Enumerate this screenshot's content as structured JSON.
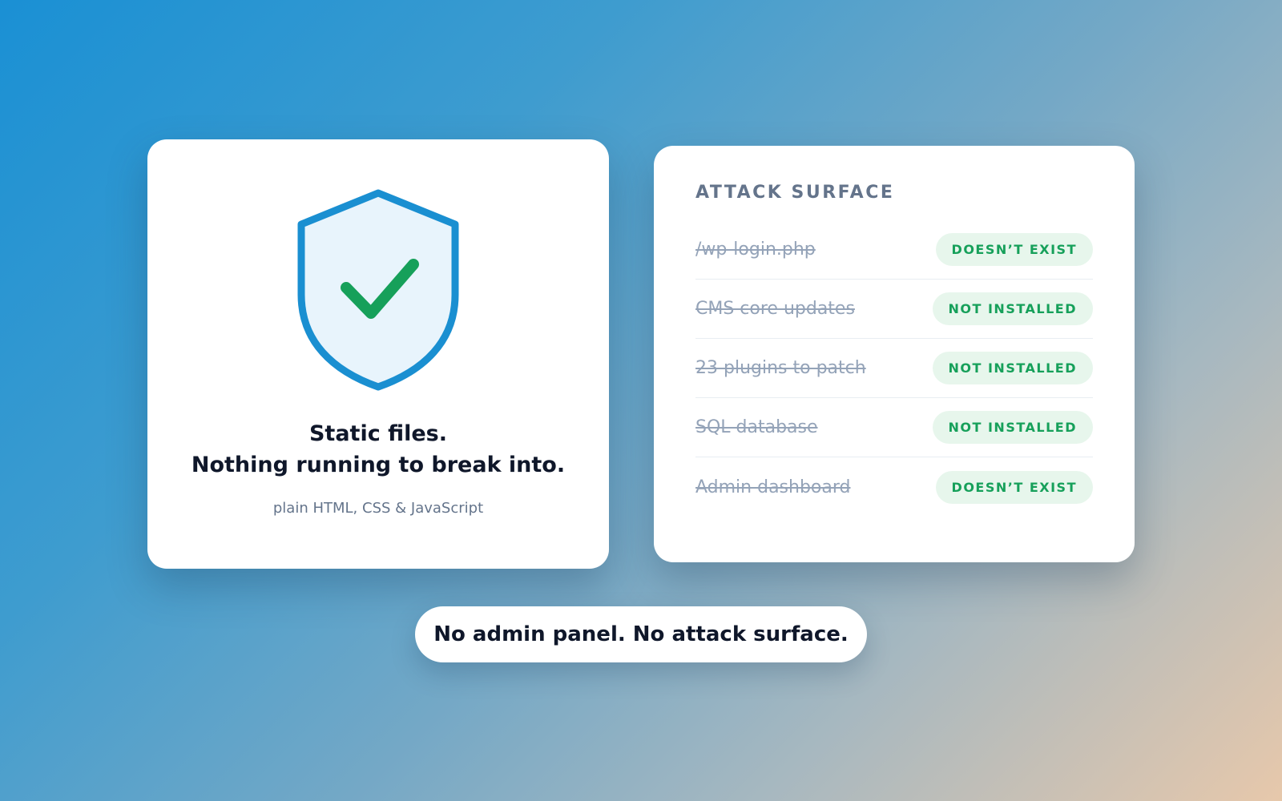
{
  "left_card": {
    "icon": "shield-check-icon",
    "headline_line1": "Static files.",
    "headline_line2": "Nothing running to break into.",
    "subtext": "plain HTML, CSS & JavaScript"
  },
  "right_card": {
    "title": "ATTACK SURFACE",
    "rows": [
      {
        "label": "/wp-login.php",
        "status": "DOESN’T EXIST"
      },
      {
        "label": "CMS core updates",
        "status": "NOT INSTALLED"
      },
      {
        "label": "23 plugins to patch",
        "status": "NOT INSTALLED"
      },
      {
        "label": "SQL database",
        "status": "NOT INSTALLED"
      },
      {
        "label": "Admin dashboard",
        "status": "DOESN’T EXIST"
      }
    ]
  },
  "footer": {
    "message": "No admin panel. No attack surface."
  },
  "colors": {
    "shield_stroke": "#1a8fd1",
    "shield_fill": "#e8f4fc",
    "check": "#16a05a",
    "badge_bg": "#e7f6ec",
    "badge_text": "#16a05a"
  }
}
